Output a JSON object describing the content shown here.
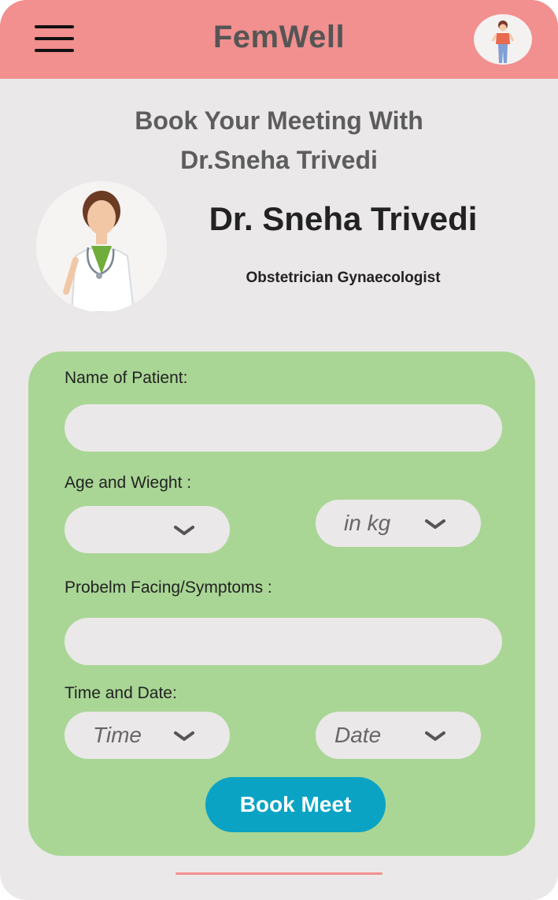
{
  "header": {
    "title": "FemWell",
    "menu_icon": "hamburger-menu-icon",
    "profile_icon": "user-avatar-icon"
  },
  "intro": {
    "line1": "Book Your Meeting With",
    "line2": "Dr.Sneha Trivedi"
  },
  "doctor": {
    "name": "Dr. Sneha Trivedi",
    "specialty": "Obstetrician Gynaecologist"
  },
  "form": {
    "patient_name_label": "Name of Patient:",
    "patient_name_value": "",
    "age_weight_label": "Age and Wieght :",
    "age_value": "",
    "weight_placeholder": "in kg",
    "symptoms_label": "Probelm Facing/Symptoms :",
    "symptoms_value": "",
    "time_date_label": "Time and Date:",
    "time_placeholder": "Time",
    "date_placeholder": "Date",
    "submit_label": "Book Meet"
  },
  "colors": {
    "header": "#f28f8f",
    "background": "#ebe8e9",
    "form_card": "#a9d695",
    "button": "#0aa3c4"
  }
}
